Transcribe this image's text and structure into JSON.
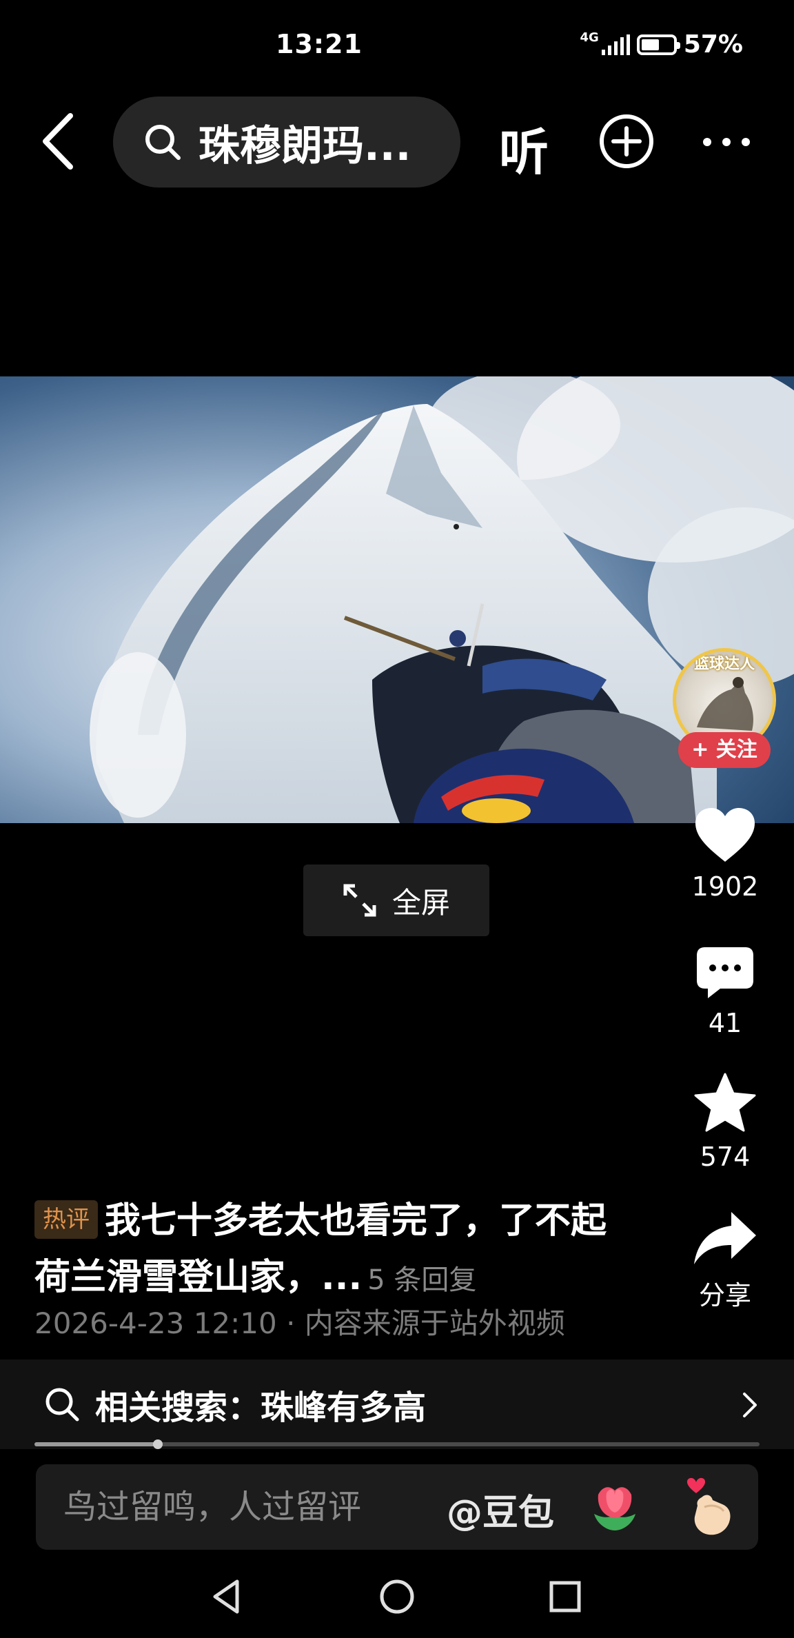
{
  "status_bar": {
    "time": "13:21",
    "network": "4G",
    "battery": "57%",
    "battery_level": 0.57
  },
  "header": {
    "search_text": "珠穆朗玛...",
    "listen_label": "听"
  },
  "author": {
    "avatar_label": "篮球达人",
    "follow_label": "+ 关注"
  },
  "actions": {
    "likes": "1902",
    "comments": "41",
    "favorites": "574",
    "share_label": "分享"
  },
  "video": {
    "fullscreen_label": "全屏",
    "progress": 0.17
  },
  "hot_comment": {
    "tag": "热评",
    "text": "我七十多老太也看完了，了不起荷兰滑雪登山家，...",
    "replies": "5 条回复",
    "meta": "2026-4-23 12:10 · 内容来源于站外视频"
  },
  "related_search": {
    "text": "相关搜索：珠峰有多高"
  },
  "comment_input": {
    "placeholder": "鸟过留鸣，人过留评",
    "mention": "@豆包"
  },
  "icons": {
    "back": "back-arrow-icon",
    "search": "search-icon",
    "add": "plus-circle-icon",
    "more": "more-dots-icon",
    "like": "heart-icon",
    "comment": "comment-bubble-icon",
    "favorite": "star-icon",
    "share": "share-arrow-icon",
    "fullscreen": "expand-icon",
    "related_chevron": "chevron-right-icon",
    "tulip": "tulip-emoji-icon",
    "heart_hand": "finger-heart-emoji-icon"
  }
}
